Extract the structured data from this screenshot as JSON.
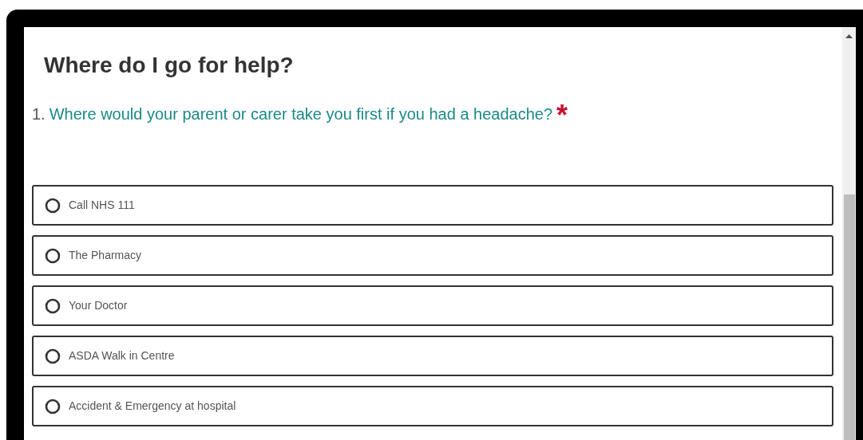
{
  "title": "Where do I go for help?",
  "question": {
    "number": "1.",
    "text": "Where would your parent or carer take you first if you had a headache?",
    "required_mark": "*"
  },
  "options": [
    {
      "label": "Call NHS 111",
      "selected": false
    },
    {
      "label": "The Pharmacy",
      "selected": false
    },
    {
      "label": "Your Doctor",
      "selected": false
    },
    {
      "label": "ASDA Walk in Centre",
      "selected": false
    },
    {
      "label": "Accident & Emergency at hospital",
      "selected": false
    }
  ]
}
